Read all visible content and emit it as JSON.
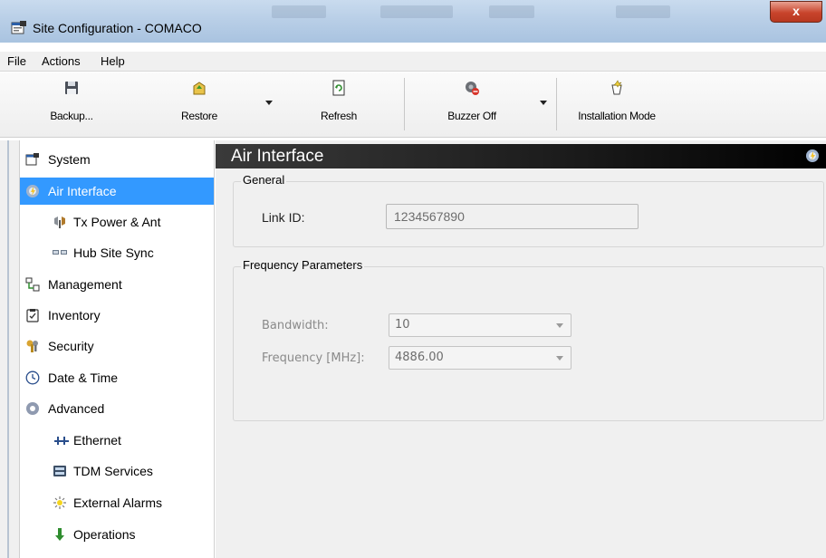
{
  "window": {
    "title": "Site Configuration - COMACO",
    "close_glyph": "x"
  },
  "menu": [
    "File",
    "Actions",
    "Help"
  ],
  "toolbar": {
    "backup_label": "Backup...",
    "restore_label": "Restore",
    "refresh_label": "Refresh",
    "buzzer_label": "Buzzer Off",
    "installation_label": "Installation Mode"
  },
  "sidebar": {
    "items": [
      {
        "label": "System",
        "icon": "system-icon"
      },
      {
        "label": "Air Interface",
        "icon": "air-interface-icon"
      },
      {
        "label": "Tx Power & Ant",
        "icon": "antenna-icon"
      },
      {
        "label": "Hub Site Sync",
        "icon": "sync-icon"
      },
      {
        "label": "Management",
        "icon": "management-icon"
      },
      {
        "label": "Inventory",
        "icon": "inventory-icon"
      },
      {
        "label": "Security",
        "icon": "security-icon"
      },
      {
        "label": "Date & Time",
        "icon": "clock-icon"
      },
      {
        "label": "Advanced",
        "icon": "gear-icon"
      },
      {
        "label": "Ethernet",
        "icon": "ethernet-icon"
      },
      {
        "label": "TDM Services",
        "icon": "tdm-icon"
      },
      {
        "label": "External Alarms",
        "icon": "alarm-icon"
      },
      {
        "label": "Operations",
        "icon": "operations-icon"
      }
    ],
    "selected": "Air Interface"
  },
  "main": {
    "title": "Air Interface",
    "general": {
      "title": "General",
      "link_id_label": "Link ID:",
      "link_id_value": "1234567890"
    },
    "frequency": {
      "title": "Frequency Parameters",
      "bandwidth_label": "Bandwidth:",
      "bandwidth_value": "10",
      "frequency_label": "Frequency [MHz]:",
      "frequency_value": "4886.00"
    }
  },
  "colors": {
    "selection": "#3399ff",
    "header_bg": "#1a1a1a",
    "panel_bg": "#f0f0f0",
    "close_button": "#c8442c"
  }
}
